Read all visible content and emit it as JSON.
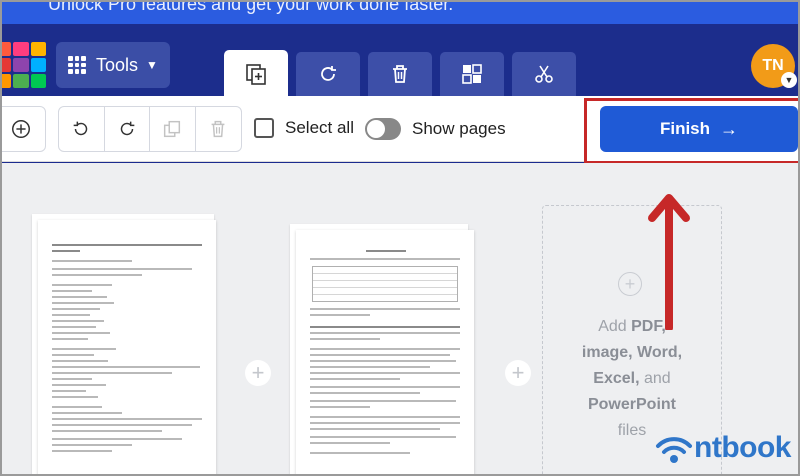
{
  "promo": {
    "text": "Unlock Pro features and get your work done faster."
  },
  "header": {
    "tools_label": "Tools",
    "tabs": [
      {
        "name": "organize",
        "icon": "copy-pages-icon",
        "active": true
      },
      {
        "name": "rotate",
        "icon": "rotate-icon",
        "active": false
      },
      {
        "name": "delete",
        "icon": "trash-icon",
        "active": false
      },
      {
        "name": "layout",
        "icon": "grid-layout-icon",
        "active": false
      },
      {
        "name": "split",
        "icon": "scissors-icon",
        "active": false
      }
    ],
    "avatar_initials": "TN"
  },
  "toolbar": {
    "select_all_label": "Select all",
    "show_pages_label": "Show pages",
    "finish_label": "Finish",
    "finish_arrow": "→"
  },
  "workspace": {
    "add_zone": {
      "add": "Add",
      "pdf": "PDF,",
      "image": "image,",
      "word": "Word,",
      "excel": "Excel,",
      "and": "and",
      "powerpoint": "PowerPoint",
      "files": "files"
    }
  },
  "watermark": {
    "text": "ntbook"
  },
  "colors": {
    "header_bg": "#1c2d8c",
    "promo_bg": "#2b5ce0",
    "finish_bg": "#1f5ad6",
    "avatar_bg": "#f29b18",
    "highlight_red": "#c62828"
  }
}
